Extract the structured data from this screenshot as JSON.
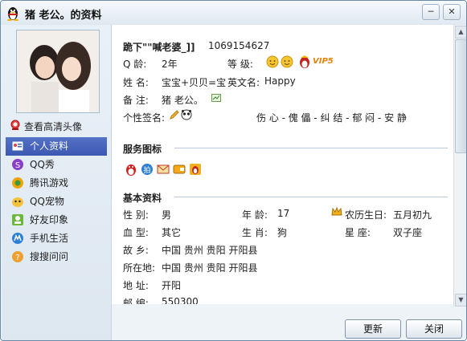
{
  "window": {
    "title": "猪 老公。的资料",
    "min_label": "─",
    "close_label": "✕"
  },
  "sidebar": {
    "hd_avatar_link": "查看高清头像",
    "items": [
      {
        "label": "个人资料",
        "selected": true,
        "icon": "profile-card-icon"
      },
      {
        "label": "QQ秀",
        "icon": "qqshow-icon"
      },
      {
        "label": "腾讯游戏",
        "icon": "game-icon"
      },
      {
        "label": "QQ宠物",
        "icon": "pet-icon"
      },
      {
        "label": "好友印象",
        "icon": "impression-icon"
      },
      {
        "label": "手机生活",
        "icon": "mobile-icon"
      },
      {
        "label": "搜搜问问",
        "icon": "question-icon"
      }
    ]
  },
  "profile": {
    "nickname": "跪下\"\"喊老婆_]]",
    "qq_number": "1069154627",
    "qage_label": "Q    龄:",
    "qage_value": "2年",
    "level_label": "等    级:",
    "vip_label": "VIP5",
    "name_label": "姓    名:",
    "name_value": "宝宝+贝贝=宝",
    "english_label": "英文名:",
    "english_value": "Happy",
    "remark_label": "备    注:",
    "remark_value": "猪 老公。",
    "signature_label": "个性签名:",
    "signature_value": "伤 心 - 傀 儡 - 纠 结 - 郁 闷 - 安 静"
  },
  "service_section": {
    "title": "服务图标",
    "icons": [
      "qq-penguin-icon",
      "paipai-icon",
      "mail-icon",
      "wallet-icon",
      "member-icon"
    ]
  },
  "basic_section": {
    "title": "基本资料",
    "gender_label": "性    别:",
    "gender_value": "男",
    "age_label": "年    龄:",
    "age_value": "17",
    "lunar_label": "农历生日:",
    "lunar_value": "五月初九",
    "blood_label": "血    型:",
    "blood_value": "其它",
    "zodiac_label": "生    肖:",
    "zodiac_value": "狗",
    "constellation_label": "星      座:",
    "constellation_value": "双子座",
    "hometown_label": "故    乡:",
    "hometown_value": "中国 贵州 贵阳 开阳县",
    "location_label": "所在地:",
    "location_value": "中国 贵州 贵阳 开阳县",
    "address_label": "地    址:",
    "address_value": "开阳",
    "zip_label": "邮    编:",
    "zip_value": "550300"
  },
  "buttons": {
    "refresh": "更新",
    "close": "关闭"
  },
  "colors": {
    "accent": "#3c58b1",
    "vip": "#e6820a",
    "window_bg": "#eef3f8"
  }
}
